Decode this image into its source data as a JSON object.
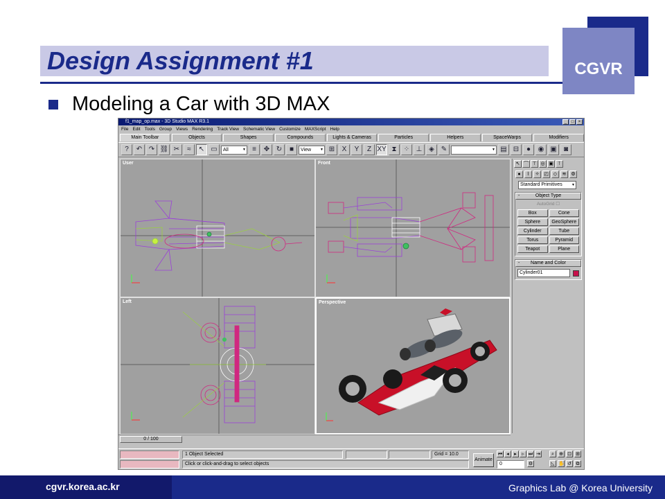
{
  "slide": {
    "title": "Design Assignment #1",
    "logo": "CGVR",
    "bullet": "Modeling a Car with 3D MAX",
    "footer_url": "cgvr.korea.ac.kr",
    "footer_lab": "Graphics Lab @ Korea University"
  },
  "window": {
    "title": "f1_map_op.max - 3D Studio MAX R3.1",
    "menu": [
      "File",
      "Edit",
      "Tools",
      "Group",
      "Views",
      "Rendering",
      "Track View",
      "Schematic View",
      "Customize",
      "MAXScript",
      "Help"
    ],
    "tabs": [
      "Main Toolbar",
      "Objects",
      "Shapes",
      "Compounds",
      "Lights & Cameras",
      "Particles",
      "Helpers",
      "SpaceWarps",
      "Modifiers"
    ],
    "toolbar": {
      "selection_filter": "All",
      "coord_system": "View",
      "axis_x": "X",
      "axis_y": "Y",
      "axis_z": "Z",
      "axis_xy": "XY"
    }
  },
  "viewports": {
    "top_left": "User",
    "top_right": "Front",
    "bottom_left": "Left",
    "bottom_right": "Perspective"
  },
  "command_panel": {
    "category": "Standard Primitives",
    "object_type_header": "Object Type",
    "autogrid": "AutoGrid",
    "buttons": [
      "Box",
      "Cone",
      "Sphere",
      "GeoSphere",
      "Cylinder",
      "Tube",
      "Torus",
      "Pyramid",
      "Teapot",
      "Plane"
    ],
    "name_color_header": "Name and Color",
    "object_name": "Cylinder01",
    "object_color": "#c8104a"
  },
  "timeline": {
    "frame": "0 / 100"
  },
  "status": {
    "selected": "1 Object Selected",
    "prompt": "Click or click-and-drag to select objects",
    "grid": "Grid = 10.0",
    "animate": "Animate",
    "current_frame": "0"
  },
  "colors": {
    "accent_blue": "#1a2a8a",
    "viewport_gray": "#a0a0a0",
    "wire_purple": "#9a40d8",
    "wire_green": "#9ad040",
    "wire_magenta": "#d02880"
  }
}
